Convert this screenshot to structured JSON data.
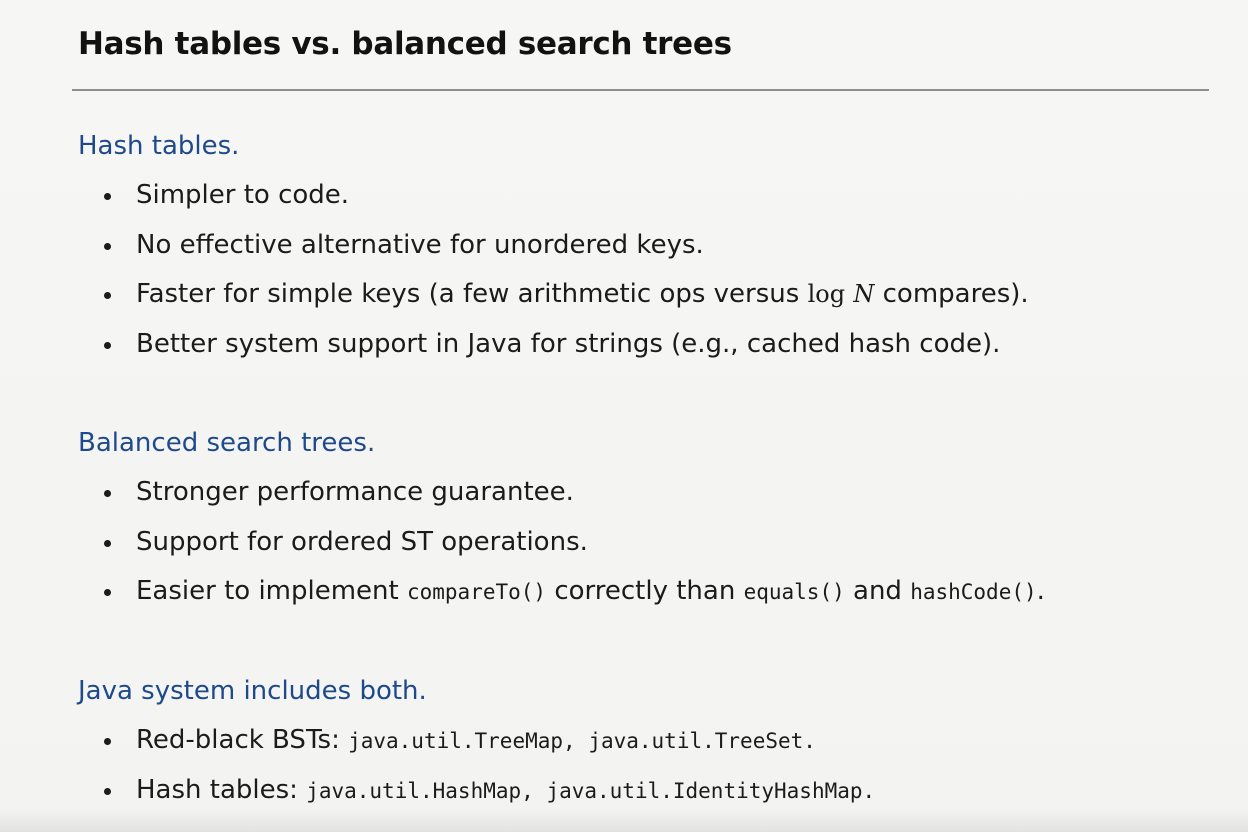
{
  "title": "Hash tables vs. balanced search trees",
  "sections": {
    "hash": {
      "heading": "Hash tables.",
      "bullets": {
        "b1": "Simpler to code.",
        "b2": "No effective alternative for unordered keys.",
        "b3": {
          "before": "Faster for simple keys (a few arithmetic ops versus ",
          "log": "log",
          "n": "N",
          "after": " compares)."
        },
        "b4": "Better system support in Java for strings (e.g., cached hash code)."
      }
    },
    "balanced": {
      "heading": "Balanced search trees.",
      "bullets": {
        "b1": "Stronger performance guarantee.",
        "b2": "Support for ordered ST operations.",
        "b3": {
          "t1": "Easier to implement ",
          "c1": "compareTo()",
          "t2": " correctly than ",
          "c2": "equals()",
          "t3": " and ",
          "c3": "hashCode()",
          "t4": "."
        }
      }
    },
    "java": {
      "heading": "Java system includes both.",
      "bullets": {
        "b1": {
          "label": "Red-black BSTs: ",
          "c1": "java.util.TreeMap",
          "sep": ", ",
          "c2": "java.util.TreeSet",
          "end": "."
        },
        "b2": {
          "label": "Hash tables: ",
          "c1": "java.util.HashMap",
          "sep": ", ",
          "c2": "java.util.IdentityHashMap",
          "end": "."
        }
      }
    }
  }
}
